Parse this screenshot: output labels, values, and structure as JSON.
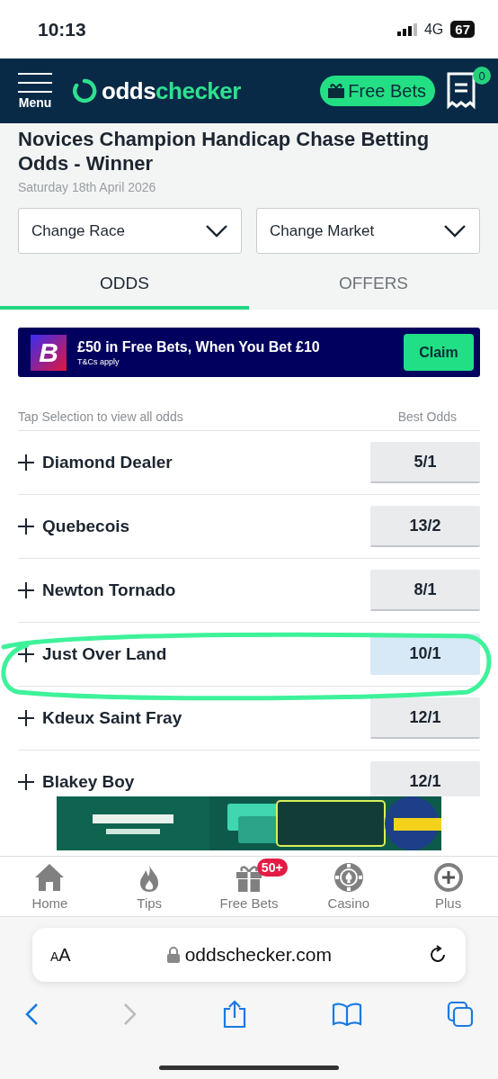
{
  "status_bar": {
    "time": "10:13",
    "network": "4G",
    "battery": "67"
  },
  "header": {
    "menu_label": "Menu",
    "logo": "oddschecker",
    "free_bets_button": "Free Bets",
    "betslip_count": "0"
  },
  "race": {
    "title": "Novices Champion Handicap Chase Betting Odds - Winner",
    "date": "Saturday 18th April 2026"
  },
  "dropdowns": [
    "Change Race",
    "Change Market"
  ],
  "tabs": [
    {
      "label": "ODDS",
      "selected": true
    },
    {
      "label": "OFFERS",
      "selected": false
    }
  ],
  "promo": {
    "logo_letter": "B",
    "headline": "£50 in Free Bets, When You Bet £10",
    "terms": "T&Cs apply",
    "button": "Claim"
  },
  "list_header": {
    "hint": "Tap Selection to view all odds",
    "column": "Best Odds"
  },
  "runners": [
    {
      "name": "Diamond Dealer",
      "odds": "5/1",
      "selected": false
    },
    {
      "name": "Quebecois",
      "odds": "13/2",
      "selected": false
    },
    {
      "name": "Newton Tornado",
      "odds": "8/1",
      "selected": false
    },
    {
      "name": "Just Over Land",
      "odds": "10/1",
      "selected": true
    },
    {
      "name": "Kdeux Saint Fray",
      "odds": "12/1",
      "selected": false
    },
    {
      "name": "Blakey Boy",
      "odds": "12/1",
      "selected": false
    }
  ],
  "bottom_nav": [
    {
      "label": "Home",
      "kind": "home"
    },
    {
      "label": "Tips",
      "kind": "tips"
    },
    {
      "label": "Free Bets",
      "kind": "gift",
      "badge": "50+"
    },
    {
      "label": "Casino",
      "kind": "casino"
    },
    {
      "label": "Plus",
      "kind": "plus"
    }
  ],
  "browser": {
    "text_size": "AA",
    "url": "oddschecker.com"
  }
}
